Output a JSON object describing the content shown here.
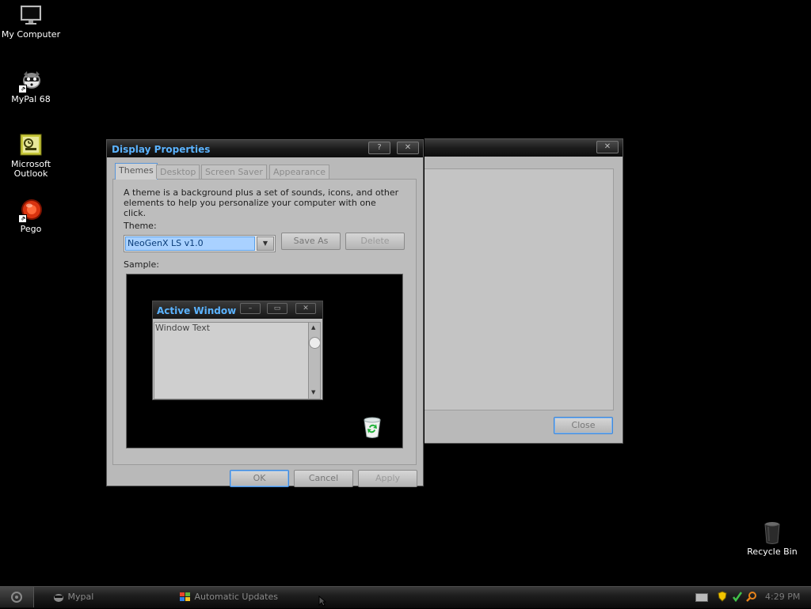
{
  "desktop": {
    "icons": [
      {
        "label": "My Computer",
        "icon": "monitor-icon"
      },
      {
        "label": "MyPal 68",
        "icon": "raccoon-icon"
      },
      {
        "label": "Microsoft Outlook",
        "icon": "outlook-icon"
      },
      {
        "label": "Pego",
        "icon": "red-orb-icon"
      },
      {
        "label": "Recycle Bin",
        "icon": "trash-can-icon"
      }
    ]
  },
  "back_window": {
    "close_label": "Close"
  },
  "dialog": {
    "title": "Display Properties",
    "help_glyph": "?",
    "close_glyph": "✕",
    "tabs": [
      "Themes",
      "Desktop",
      "Screen Saver",
      "Appearance"
    ],
    "description": "A theme is a background plus a set of sounds, icons, and other elements to help you personalize your computer with one click.",
    "theme_label": "Theme:",
    "theme_value": "NeoGenX LS v1.0",
    "save_as_label": "Save As",
    "delete_label": "Delete",
    "sample_label": "Sample:",
    "ok_label": "OK",
    "cancel_label": "Cancel",
    "apply_label": "Apply"
  },
  "sample": {
    "window_title": "Active Window",
    "window_text": "Window Text"
  },
  "taskbar": {
    "items": [
      {
        "label": "Mypal",
        "icon": "raccoon-icon"
      },
      {
        "label": "Automatic Updates",
        "icon": "windows-logo-icon"
      }
    ],
    "clock": "4:29 PM"
  },
  "colors": {
    "title_text": "#5bb3ff",
    "focus_blue": "#3f88d9",
    "window_face": "#b9b9b9"
  }
}
